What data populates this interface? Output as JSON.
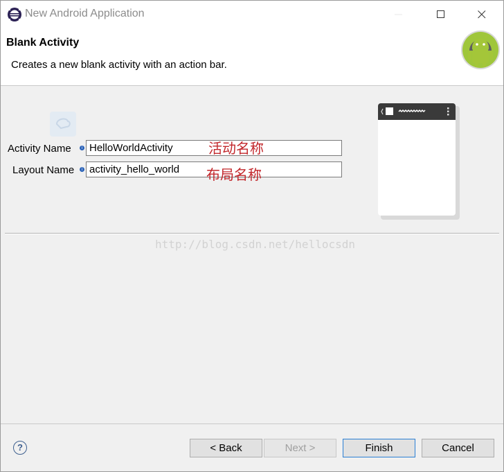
{
  "window": {
    "title": "New Android Application"
  },
  "header": {
    "title": "Blank Activity",
    "description": "Creates a new blank activity with an action bar."
  },
  "form": {
    "activity_name_label": "Activity Name",
    "activity_name_value": "HelloWorldActivity",
    "layout_name_label": "Layout Name",
    "layout_name_value": "activity_hello_world",
    "activity_annotation": "活动名称",
    "layout_annotation": "布局名称",
    "info_marker": "i"
  },
  "watermark": "http://blog.csdn.net/hellocsdn",
  "footer": {
    "help_label": "?",
    "back_label": "< Back",
    "next_label": "Next >",
    "finish_label": "Finish",
    "cancel_label": "Cancel"
  },
  "icons": {
    "app": "eclipse-icon",
    "logo": "android-logo-icon",
    "preview": "phone-preview-icon"
  },
  "colors": {
    "annotation": "#c2272b",
    "finish_border": "#2a7fd4",
    "android_green": "#9fc63b"
  }
}
